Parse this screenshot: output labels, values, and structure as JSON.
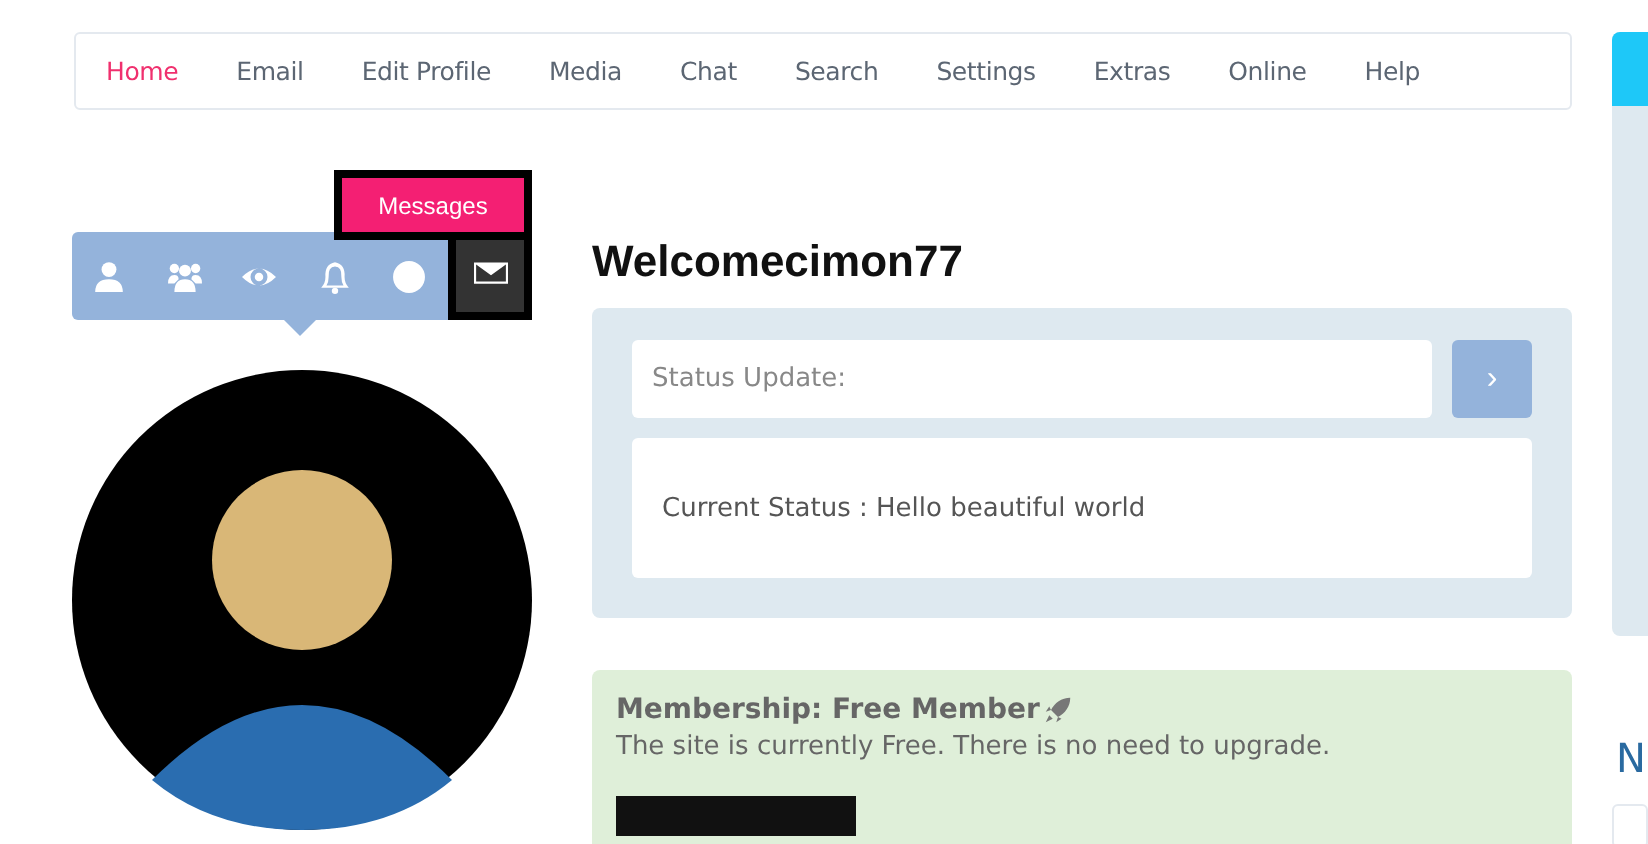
{
  "nav": [
    {
      "label": "Home",
      "selected": true
    },
    {
      "label": "Email",
      "selected": false
    },
    {
      "label": "Edit Profile",
      "selected": false
    },
    {
      "label": "Media",
      "selected": false
    },
    {
      "label": "Chat",
      "selected": false
    },
    {
      "label": "Search",
      "selected": false
    },
    {
      "label": "Settings",
      "selected": false
    },
    {
      "label": "Extras",
      "selected": false
    },
    {
      "label": "Online",
      "selected": false
    },
    {
      "label": "Help",
      "selected": false
    }
  ],
  "profile_icons": [
    {
      "kind": "user",
      "selected": false
    },
    {
      "kind": "users",
      "selected": false
    },
    {
      "kind": "eye",
      "selected": false
    },
    {
      "kind": "bell",
      "selected": false
    },
    {
      "kind": "circle",
      "selected": false
    },
    {
      "kind": "envelope",
      "selected": true
    }
  ],
  "tooltip": "Messages",
  "welcome": "Welcomecimon77",
  "status": {
    "placeholder": "Status Update:",
    "submit": "›",
    "current": "Current Status : Hello beautiful world"
  },
  "membership": {
    "title": "Membership: Free Member",
    "text": "The site is currently Free. There is no need to upgrade."
  },
  "side_heading": "N"
}
